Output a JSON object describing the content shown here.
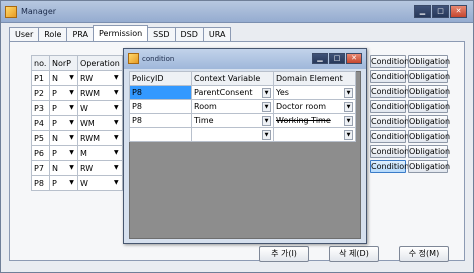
{
  "window": {
    "title": "Manager"
  },
  "tabs": [
    {
      "label": "User"
    },
    {
      "label": "Role"
    },
    {
      "label": "PRA"
    },
    {
      "label": "Permission"
    },
    {
      "label": "SSD"
    },
    {
      "label": "DSD"
    },
    {
      "label": "URA"
    }
  ],
  "active_tab": "Permission",
  "permission_grid": {
    "headers": {
      "no": "no.",
      "norp": "NorP",
      "operation": "Operation"
    },
    "rows": [
      {
        "no": "P1",
        "norp": "N",
        "op": "RW"
      },
      {
        "no": "P2",
        "norp": "P",
        "op": "RWM"
      },
      {
        "no": "P3",
        "norp": "P",
        "op": "W"
      },
      {
        "no": "P4",
        "norp": "P",
        "op": "WM"
      },
      {
        "no": "P5",
        "norp": "N",
        "op": "RWM"
      },
      {
        "no": "P6",
        "norp": "P",
        "op": "M"
      },
      {
        "no": "P7",
        "norp": "N",
        "op": "RW"
      },
      {
        "no": "P8",
        "norp": "P",
        "op": "W"
      }
    ]
  },
  "right_buttons": {
    "condition_label": "Condition",
    "obligation_label": "Obligation",
    "row_count": 8,
    "selected_condition_row": 8
  },
  "bottom_buttons": {
    "add": "추 가(I)",
    "delete": "삭 제(D)",
    "edit": "수 정(M)"
  },
  "dialog": {
    "title": "condition",
    "headers": {
      "policy_id": "PolicyID",
      "context_variable": "Context Variable",
      "domain_element": "Domain Element"
    },
    "rows": [
      {
        "policy_id": "P8",
        "context": "ParentConsent",
        "domain": "Yes"
      },
      {
        "policy_id": "P8",
        "context": "Room",
        "domain": "Doctor room"
      },
      {
        "policy_id": "P8",
        "context": "Time",
        "domain": "Working Time"
      },
      {
        "policy_id": "",
        "context": "",
        "domain": ""
      }
    ]
  },
  "icons": {
    "minimize": "minimize-icon",
    "maximize": "maximize-icon",
    "close": "close-icon",
    "dropdown": "chevron-down-icon"
  },
  "colors": {
    "selected_cell": "#3399ff",
    "selected_button": "#b4d9fb"
  }
}
